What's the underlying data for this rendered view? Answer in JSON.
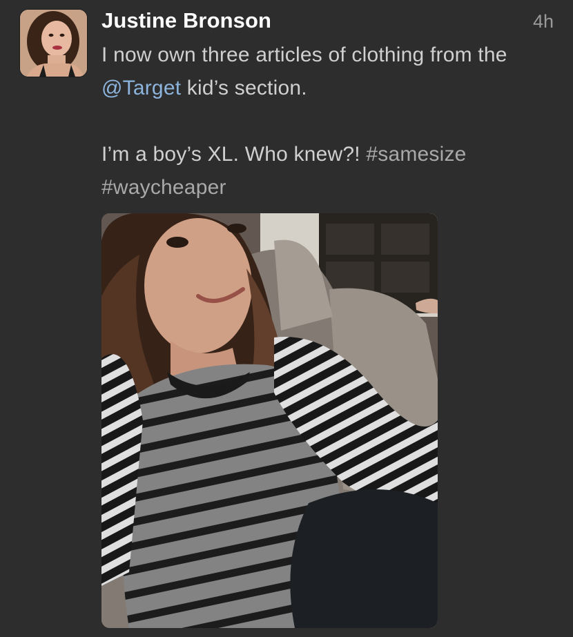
{
  "tweet": {
    "author_name": "Justine Bronson",
    "timestamp": "4h",
    "line1_pre": "I now own three articles of clothing from the ",
    "mention": "@Target",
    "line1_post": " kid’s section.",
    "line2_pre": "I’m a boy’s XL. Who knew?! ",
    "hashtag1": "#samesize",
    "hashtag2": "#waycheaper"
  },
  "colors": {
    "background": "#2d2d2d",
    "author": "#ffffff",
    "body_text": "#d0d0d0",
    "mention": "#8cb4dc",
    "hashtag": "#a9a9a9",
    "timestamp": "#9a9a9a"
  },
  "icons": {
    "avatar": "profile-photo",
    "media": "selfie-photo"
  }
}
